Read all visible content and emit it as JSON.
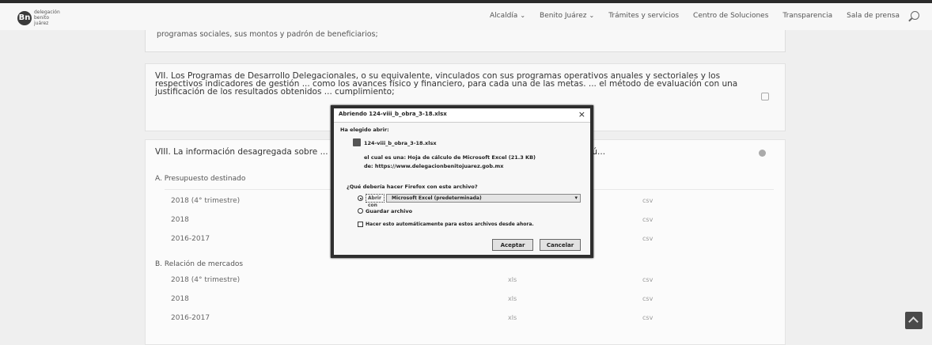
{
  "logo": {
    "mark": "Bn",
    "text": "delegación benito juárez"
  },
  "nav": {
    "items": [
      {
        "label": "Alcaldía",
        "caret": "⌄"
      },
      {
        "label": "Benito Juárez",
        "caret": "⌄"
      },
      {
        "label": "Trámites y servicios",
        "caret": ""
      },
      {
        "label": "Centro de Soluciones",
        "caret": ""
      },
      {
        "label": "Transparencia",
        "caret": ""
      },
      {
        "label": "Sala de prensa",
        "caret": ""
      }
    ]
  },
  "cards": {
    "top_text": "programas sociales, sus montos y padrón de beneficiarios;",
    "vii_text": "VII. Los Programas de Desarrollo Delegacionales, o su equivalente, vinculados con sus programas operativos anuales y sectoriales y los respectivos indicadores de gestión ... como los avances físico y financiero, para cada una de las metas. ... el método de evaluación con una justificación de los resultados obtenidos ... cumplimiento;",
    "viii_title": "VIII. La información desagregada sobre ... el padrón de locatarios, nombre y ubicación de los mercados pú...",
    "section_a": "A. Presupuesto destinado",
    "section_b": "B. Relación de mercados",
    "rows_a": [
      {
        "period": "2018 (4° trimestre)",
        "fmt2": "csv"
      },
      {
        "period": "2018",
        "fmt2": "csv"
      },
      {
        "period": "2016-2017",
        "fmt2": "csv"
      }
    ],
    "rows_b": [
      {
        "period": "2018 (4° trimestre)",
        "fmt1": "xls",
        "fmt2": "csv"
      },
      {
        "period": "2018",
        "fmt1": "xls",
        "fmt2": "csv"
      },
      {
        "period": "2016-2017",
        "fmt1": "xls",
        "fmt2": "csv"
      }
    ]
  },
  "dialog": {
    "title": "Abriendo 124-viii_b_obra_3-18.xlsx",
    "close": "×",
    "heading": "Ha elegido abrir:",
    "filename": "124-viii_b_obra_3-18.xlsx",
    "type_line": "el cual es una: Hoja de cálculo de Microsoft Excel (21.3 KB)",
    "from_line": "de: https://www.delegacionbenitojuarez.gob.mx",
    "question": "¿Qué debería hacer Firefox con este archivo?",
    "open_with_label": "Abrir con",
    "open_with_value": "Microsoft Excel (predeterminada)",
    "save_label": "Guardar archivo",
    "remember_label": "Hacer esto automáticamente para estos archivos desde ahora.",
    "accept": "Aceptar",
    "cancel": "Cancelar"
  }
}
